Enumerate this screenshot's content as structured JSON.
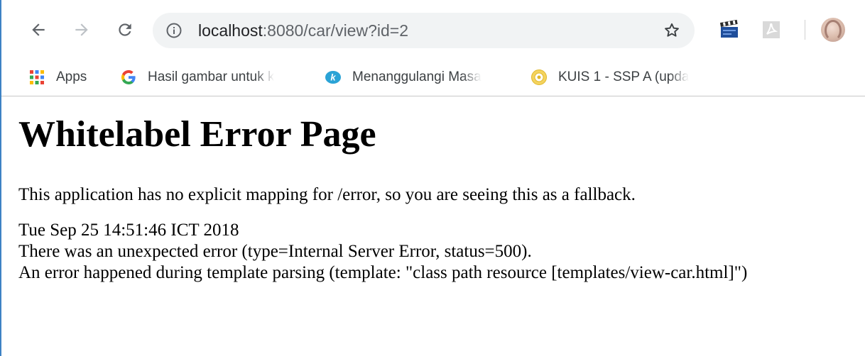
{
  "browser": {
    "url_host": "localhost",
    "url_rest": ":8080/car/view?id=2",
    "bookmarks": [
      {
        "icon": "apps-grid-icon",
        "label": "Apps"
      },
      {
        "icon": "google-icon",
        "label": "Hasil gambar untuk k"
      },
      {
        "icon": "kompasiana-icon",
        "label": "Menanggulangi Masa"
      },
      {
        "icon": "university-seal-icon",
        "label": "KUIS 1 - SSP A (upda"
      }
    ]
  },
  "page": {
    "title": "Whitelabel Error Page",
    "message": "This application has no explicit mapping for /error, so you are seeing this as a fallback.",
    "timestamp": "Tue Sep 25 14:51:46 ICT 2018",
    "error_line": "There was an unexpected error (type=Internal Server Error, status=500).",
    "detail_line": "An error happened during template parsing (template: \"class path resource [templates/view-car.html]\")"
  },
  "colors": {
    "omnibox_bg": "#f1f3f4",
    "accent": "#3d82c4"
  }
}
